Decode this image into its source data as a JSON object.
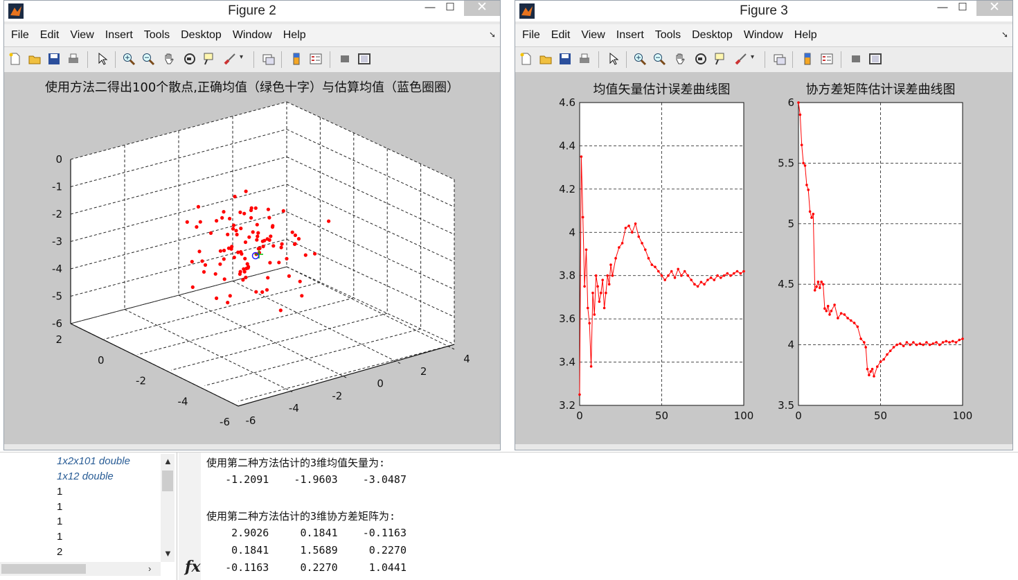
{
  "windows": [
    {
      "title": "Figure 2",
      "menu": [
        "File",
        "Edit",
        "View",
        "Insert",
        "Tools",
        "Desktop",
        "Window",
        "Help"
      ],
      "plot": {
        "title": "使用方法二得出100个散点,正确均值（绿色十字）与估算均值（蓝色圈圈）",
        "z_ticks": [
          "0",
          "-1",
          "-2",
          "-3",
          "-4",
          "-5",
          "-6"
        ],
        "y_ticks_left": [
          "2",
          "0",
          "-2",
          "-4",
          "-6"
        ],
        "x_ticks_right": [
          "-6",
          "-4",
          "-2",
          "0",
          "2",
          "4"
        ]
      }
    },
    {
      "title": "Figure 3",
      "menu": [
        "File",
        "Edit",
        "View",
        "Insert",
        "Tools",
        "Desktop",
        "Window",
        "Help"
      ]
    }
  ],
  "window_buttons": {
    "min": "—",
    "max": "☐",
    "close": "✕"
  },
  "chart_data": [
    {
      "type": "scatter",
      "title": "使用方法二得出100个散点,正确均值（绿色十字）与估算均值（蓝色圈圈）",
      "note_dimension": "3d",
      "xlim": [
        -6,
        4
      ],
      "ylim": [
        -6,
        2
      ],
      "zlim": [
        -6,
        0
      ],
      "series": [
        {
          "marker": "red-dot",
          "color": "#ff0000",
          "points_screen_approx": 100
        },
        {
          "name": "",
          "marker": "green-plus",
          "color": "#00c000"
        },
        {
          "name": "",
          "marker": "blue-circle",
          "color": "#2020ff"
        }
      ]
    },
    {
      "type": "line",
      "title": "均值矢量估计误差曲线图",
      "xlim": [
        0,
        100
      ],
      "ylim": [
        3.2,
        4.6
      ],
      "xticks": [
        "0",
        "50",
        "100"
      ],
      "yticks": [
        "3.2",
        "3.4",
        "3.6",
        "3.8",
        "4",
        "4.2",
        "4.4",
        "4.6"
      ],
      "grid": true,
      "series": [
        {
          "color": "#ff0000",
          "x": [
            0,
            1,
            2,
            3,
            4,
            5,
            6,
            7,
            8,
            9,
            10,
            11,
            12,
            13,
            14,
            15,
            16,
            17,
            18,
            19,
            20,
            22,
            24,
            26,
            28,
            30,
            32,
            34,
            36,
            38,
            40,
            42,
            44,
            46,
            48,
            50,
            52,
            54,
            56,
            58,
            60,
            62,
            64,
            66,
            68,
            70,
            72,
            74,
            76,
            78,
            80,
            82,
            84,
            86,
            88,
            90,
            92,
            94,
            96,
            98,
            100
          ],
          "values": [
            3.25,
            4.35,
            4.07,
            3.75,
            3.92,
            3.65,
            3.58,
            3.38,
            3.72,
            3.62,
            3.8,
            3.75,
            3.68,
            3.72,
            3.78,
            3.65,
            3.72,
            3.8,
            3.76,
            3.85,
            3.8,
            3.88,
            3.93,
            3.95,
            4.02,
            4.03,
            4.0,
            4.04,
            3.98,
            3.95,
            3.92,
            3.88,
            3.85,
            3.84,
            3.82,
            3.8,
            3.78,
            3.8,
            3.82,
            3.79,
            3.83,
            3.8,
            3.82,
            3.8,
            3.78,
            3.76,
            3.75,
            3.77,
            3.76,
            3.78,
            3.79,
            3.78,
            3.8,
            3.79,
            3.8,
            3.81,
            3.8,
            3.81,
            3.82,
            3.81,
            3.82
          ]
        }
      ]
    },
    {
      "type": "line",
      "title": "协方差矩阵估计误差曲线图",
      "xlim": [
        0,
        100
      ],
      "ylim": [
        3.5,
        6
      ],
      "xticks": [
        "0",
        "50",
        "100"
      ],
      "yticks": [
        "3.5",
        "4",
        "4.5",
        "5",
        "5.5",
        "6"
      ],
      "grid": true,
      "series": [
        {
          "color": "#ff0000",
          "x": [
            0,
            1,
            2,
            3,
            4,
            5,
            6,
            7,
            8,
            9,
            10,
            11,
            12,
            13,
            14,
            15,
            16,
            17,
            18,
            19,
            20,
            22,
            24,
            26,
            28,
            30,
            32,
            34,
            36,
            38,
            40,
            41,
            42,
            43,
            44,
            45,
            46,
            48,
            50,
            52,
            54,
            56,
            58,
            60,
            62,
            64,
            66,
            68,
            70,
            72,
            74,
            76,
            78,
            80,
            82,
            84,
            86,
            88,
            90,
            92,
            94,
            96,
            98,
            100
          ],
          "values": [
            6.0,
            5.9,
            5.65,
            5.5,
            5.48,
            5.32,
            5.28,
            5.1,
            5.05,
            5.08,
            4.45,
            4.48,
            4.52,
            4.47,
            4.52,
            4.5,
            4.3,
            4.28,
            4.32,
            4.25,
            4.28,
            4.33,
            4.22,
            4.26,
            4.25,
            4.22,
            4.2,
            4.18,
            4.15,
            4.05,
            4.02,
            3.98,
            3.8,
            3.75,
            3.78,
            3.8,
            3.74,
            3.82,
            3.86,
            3.88,
            3.92,
            3.95,
            3.98,
            4.0,
            4.01,
            3.99,
            4.02,
            4.0,
            4.02,
            4.0,
            4.01,
            4.0,
            4.02,
            4.0,
            4.01,
            4.02,
            4.0,
            4.02,
            4.03,
            4.02,
            4.03,
            4.02,
            4.04,
            4.05
          ]
        }
      ]
    }
  ],
  "workspace": {
    "rows": [
      "1x2x101 double",
      "1x12 double",
      "1",
      "1",
      "1",
      "1",
      "2"
    ]
  },
  "command_window": {
    "line1": "使用第二种方法估计的3维均值矢量为:",
    "line2": "   -1.2091    -1.9603    -3.0487",
    "line3": "使用第二种方法估计的3维协方差矩阵为:",
    "row1": "    2.9026     0.1841    -0.1163",
    "row2": "    0.1841     1.5689     0.2270",
    "row3": "   -0.1163     0.2270     1.0441",
    "fx": "fx"
  }
}
